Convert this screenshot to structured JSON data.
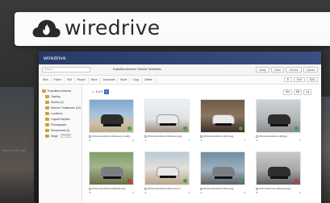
{
  "brand": {
    "name": "wiredrive"
  },
  "window": {
    "app_title": "wiredrive",
    "search_placeholder": "Search",
    "project_title": "Expedition America / Director Treatments",
    "top_buttons": [
      "Notify",
      "Share",
      "Get link",
      "Upload"
    ],
    "toolbar": [
      "New",
      "Folder",
      "Edit",
      "Report",
      "Move",
      "Download",
      "Move",
      "Copy",
      "Delete"
    ],
    "toolbar_right": [
      "8",
      "Sort",
      "Grid"
    ],
    "pager": {
      "prefix": "1 - 8 of 8",
      "pages": [
        "1"
      ]
    },
    "view_buttons": [
      "Sm",
      "Md",
      "Lg"
    ],
    "colors": {
      "titlebar": "#283a66",
      "folder": "#c9a43d",
      "approved": "#3aa346",
      "rejected": "#d33333"
    }
  },
  "sidebar": {
    "items": [
      {
        "label": "Expedition America",
        "level": 0
      },
      {
        "label": "Casting",
        "level": 1
      },
      {
        "label": "Stories (3)",
        "level": 1
      },
      {
        "label": "Director Treatments (15)",
        "level": 1
      },
      {
        "label": "Locations",
        "level": 1
      },
      {
        "label": "Logos/Graphics",
        "level": 1
      },
      {
        "label": "Photographs",
        "level": 1
      },
      {
        "label": "Storyboards (3)",
        "level": 1
      },
      {
        "label": "Stage",
        "level": 1,
        "tag": "Empty"
      }
    ]
  },
  "assets": [
    {
      "name": "2014-Land-Rover-Discovery-4-rally...",
      "status": "approved"
    },
    {
      "name": "2014-Land-Rover-Discovery.jpg",
      "status": "approved"
    },
    {
      "name": "2014-Land-Rover-LR4-3.jpg",
      "status": "approved"
    },
    {
      "name": "2014-Land-Rover-LR4 jpg",
      "status": "approved"
    },
    {
      "name": "2014-Land-Rover-Defender.jpg",
      "status": "rejected"
    },
    {
      "name": "2014-Land-Rover-Discovery-4...",
      "status": "approved"
    },
    {
      "name": "2014-Land-Rover-LR4-2.jpg",
      "status": "approved"
    },
    {
      "name": "2017-land-rover-discovery.jpg",
      "status": "rejected"
    }
  ],
  "background": {
    "left_caption": "America_03.mp4",
    "right_caption": "sign"
  }
}
